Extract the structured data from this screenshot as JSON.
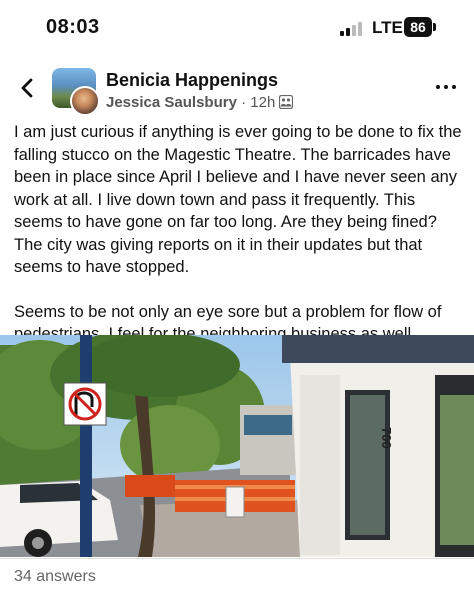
{
  "status_bar": {
    "time": "08:03",
    "network": "LTE",
    "battery": "86"
  },
  "header": {
    "group_name": "Benicia Happenings",
    "author": "Jessica Saulsbury",
    "separator": " · ",
    "time_ago": "12h",
    "icons": {
      "back": "chevron-left-icon",
      "privacy": "group-privacy-icon",
      "more": "more-dots-icon"
    }
  },
  "post": {
    "paragraphs": [
      "I am just curious if anything is ever going to be done to fix the falling stucco on the Magestic Theatre. The barricades have been in place since April I believe and I have never seen any work at all. I live down town and pass it frequently. This seems to have gone on far too long. Are they being fined? The city was giving reports on it in their updates but that seems to have stopped.",
      "Seems to be not only an eye sore but a problem for flow of pedestrians. I feel for the neighboring business as well."
    ]
  },
  "photo": {
    "building_number": "700"
  },
  "footer": {
    "answers": "34 answers"
  }
}
